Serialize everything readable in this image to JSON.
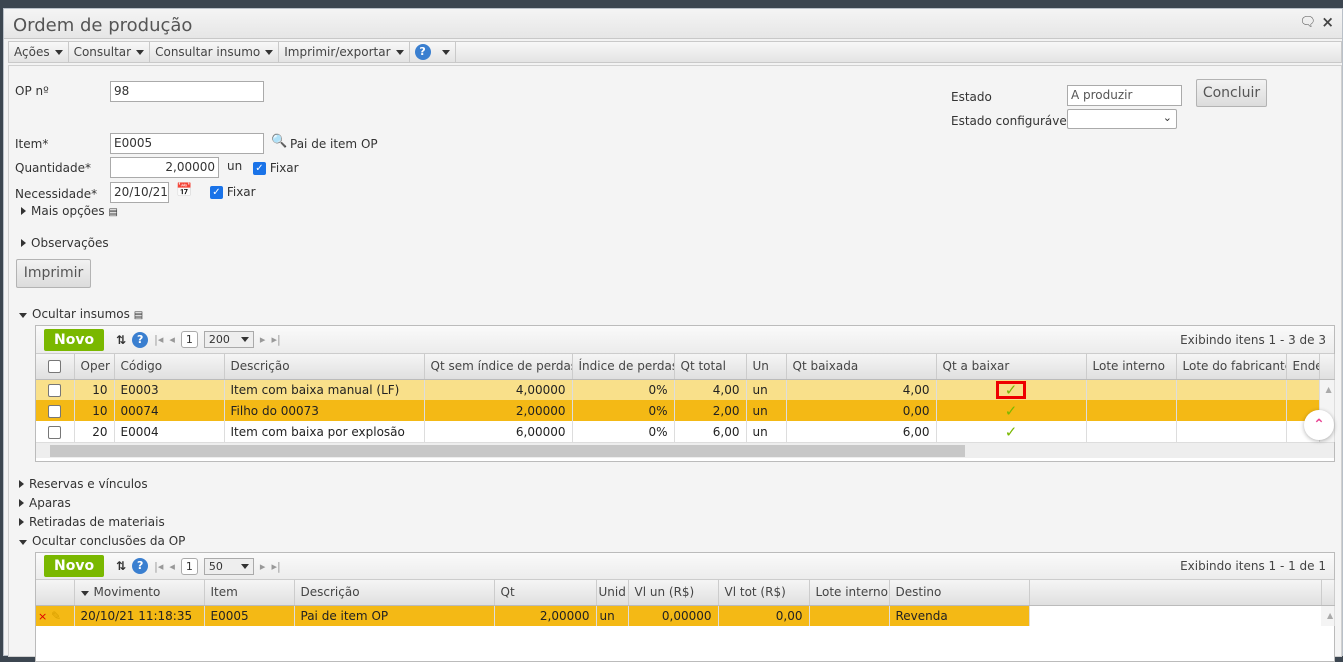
{
  "window": {
    "title": "Ordem de produção"
  },
  "menu": [
    {
      "label": "Ações"
    },
    {
      "label": "Consultar"
    },
    {
      "label": "Consultar insumo"
    },
    {
      "label": "Imprimir/exportar"
    }
  ],
  "help_label": "?",
  "form": {
    "op_label": "OP nº",
    "op_value": "98",
    "item_label": "Item*",
    "item_value": "E0005",
    "item_desc": "Pai de item OP",
    "qty_label": "Quantidade*",
    "qty_value": "2,00000",
    "qty_unit": "un",
    "fix_label": "Fixar",
    "need_label": "Necessidade*",
    "need_value": "20/10/21",
    "fix2_label": "Fixar",
    "more_options": "Mais opções",
    "observations": "Observações",
    "print_button": "Imprimir",
    "state_label": "Estado",
    "state_value": "A produzir",
    "configurable_state_label": "Estado configurável",
    "configurable_state_value": "",
    "conclude_button": "Concluir"
  },
  "inputs_section": {
    "toggle": "Ocultar insumos",
    "new_button": "Novo",
    "page": "1",
    "page_size": "200",
    "showing": "Exibindo itens 1 - 3 de 3",
    "columns": [
      "Oper",
      "Código",
      "Descrição",
      "Qt sem índice de perdas",
      "Índice de perdas",
      "Qt total",
      "Un",
      "Qt baixada",
      "Qt a baixar",
      "Lote interno",
      "Lote do fabricante",
      "Ende"
    ],
    "rows": [
      {
        "oper": "10",
        "code": "E0003",
        "desc": "Item com baixa manual (LF)",
        "qt_sem": "4,00000",
        "indice": "0%",
        "qt_total": "4,00",
        "un": "un",
        "qt_baixada": "4,00"
      },
      {
        "oper": "10",
        "code": "00074",
        "desc": "Filho do 00073",
        "qt_sem": "2,00000",
        "indice": "0%",
        "qt_total": "2,00",
        "un": "un",
        "qt_baixada": "0,00"
      },
      {
        "oper": "20",
        "code": "E0004",
        "desc": "Item com baixa por explosão",
        "qt_sem": "6,00000",
        "indice": "0%",
        "qt_total": "6,00",
        "un": "un",
        "qt_baixada": "6,00"
      }
    ]
  },
  "sections": {
    "reservas": "Reservas e vínculos",
    "aparas": "Aparas",
    "retiradas": "Retiradas de materiais",
    "conclusoes": "Ocultar conclusões da OP"
  },
  "conclusions": {
    "new_button": "Novo",
    "page": "1",
    "page_size": "50",
    "showing": "Exibindo itens 1 - 1 de 1",
    "columns": [
      "Movimento",
      "Item",
      "Descrição",
      "Qt",
      "Unid",
      "Vl un (R$)",
      "Vl tot (R$)",
      "Lote interno",
      "Destino"
    ],
    "rows": [
      {
        "movimento": "20/10/21 11:18:35",
        "item": "E0005",
        "desc": "Pai de item OP",
        "qt": "2,00000",
        "unid": "un",
        "vl_un": "0,00000",
        "vl_tot": "0,00",
        "lote": "",
        "destino": "Revenda"
      }
    ]
  }
}
